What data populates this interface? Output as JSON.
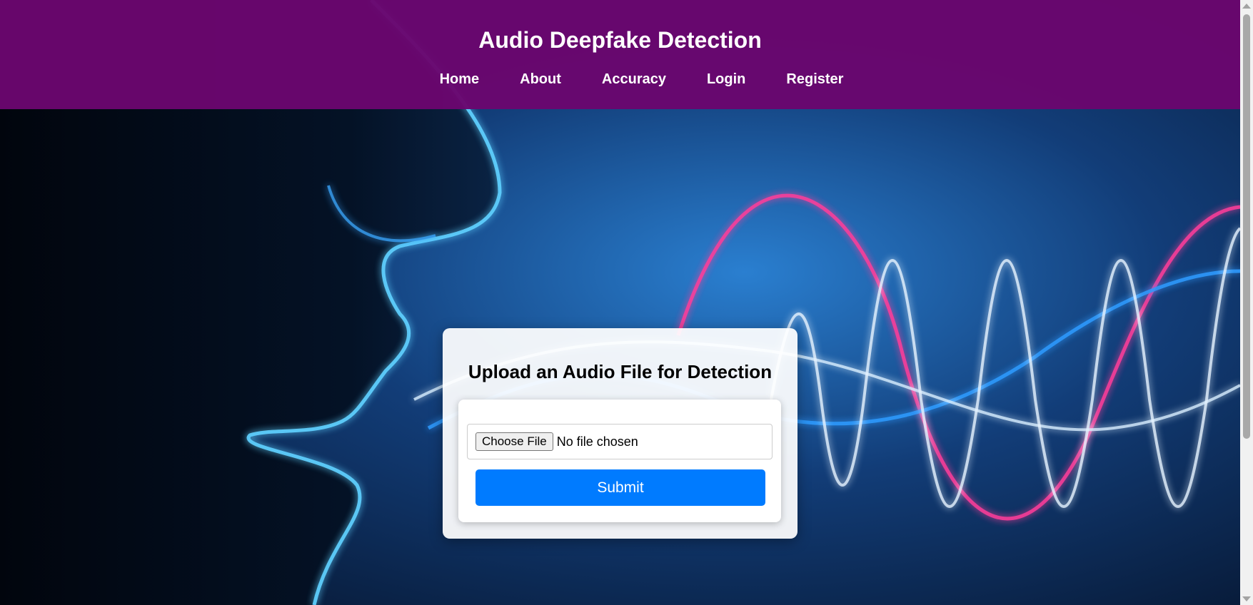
{
  "header": {
    "title": "Audio Deepfake Detection",
    "nav": [
      "Home",
      "About",
      "Accuracy",
      "Login",
      "Register"
    ]
  },
  "upload_card": {
    "title": "Upload an Audio File for Detection",
    "choose_file_label": "Choose File",
    "file_status": "No file chosen",
    "submit_label": "Submit"
  },
  "colors": {
    "header_bg": "#6a066e",
    "submit_bg": "#007bff",
    "background": "#0a2a55"
  },
  "icons": {
    "scroll_up": "scroll-up-arrow-icon",
    "scroll_down": "scroll-down-arrow-icon"
  }
}
